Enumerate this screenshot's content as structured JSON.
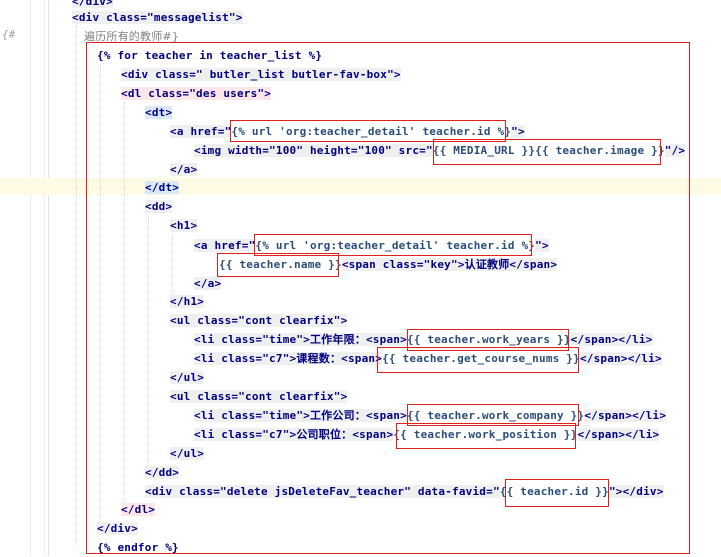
{
  "gutter": {
    "comment_marker": "{#"
  },
  "code": {
    "line_top": "</div>",
    "line_messagelist_open": "<div class=\"messagelist\">",
    "line_comment": "遍历所有的教师#}",
    "line_for": "{% for teacher in teacher_list %}",
    "line_div_butler": "<div class=\" butler_list butler-fav-box\">",
    "line_dl_open": "<dl class=\"des users\">",
    "line_dt_open": "<dt>",
    "line_a1_prefix": "<a href=\"",
    "line_a1_tpl": "{% url 'org:teacher_detail' teacher.id %}",
    "line_a1_suffix": "\">",
    "line_img_prefix": "<img width=\"100\" height=\"100\" src=\"",
    "line_img_tpl": "{{ MEDIA_URL }}{{ teacher.image }}",
    "line_img_suffix": "\"/>",
    "line_a1_close": "</a>",
    "line_dt_close": "</dt>",
    "line_dd_open": "<dd>",
    "line_h1_open": "<h1>",
    "line_a2_prefix": "<a href=\"",
    "line_a2_tpl": "{% url 'org:teacher_detail' teacher.id %}",
    "line_a2_suffix": "\">",
    "line_name_tpl": "{{ teacher.name }}",
    "line_name_rest": "<span class=\"key\">认证教师</span>",
    "line_a2_close": "</a>",
    "line_h1_close": "</h1>",
    "line_ul1_open": "<ul class=\"cont clearfix\">",
    "line_li1_prefix": "<li class=\"time\">工作年限：<span>",
    "line_li1_tpl": "{{ teacher.work_years }}",
    "line_li1_suffix": "</span></li>",
    "line_li2_prefix": "<li class=\"c7\">课程数：<span>",
    "line_li2_tpl": "{{ teacher.get_course_nums }}",
    "line_li2_suffix": "</span></li>",
    "line_ul1_close": "</ul>",
    "line_ul2_open": "<ul class=\"cont clearfix\">",
    "line_li3_prefix": "<li class=\"time\">工作公司：<span>",
    "line_li3_tpl": "{{ teacher.work_company }}",
    "line_li3_suffix": "</span></li>",
    "line_li4_prefix": "<li class=\"c7\">公司职位：<span>",
    "line_li4_tpl": "{{ teacher.work_position }}",
    "line_li4_suffix": "</span></li>",
    "line_ul2_close": "</ul>",
    "line_dd_close": "</dd>",
    "line_del_prefix": "<div class=\"delete jsDeleteFav_teacher\" data-favid=\"",
    "line_del_tpl": "{{ teacher.id }}",
    "line_del_suffix": "\"></div>",
    "line_dl_close": "</dl>",
    "line_div_close": "</div>",
    "line_endfor": "{% endfor %}"
  },
  "colors": {
    "highlight_box": "#e0201a",
    "tag": "#000080",
    "attribute": "#0000ff",
    "value": "#008000",
    "current_line": "#fffae3"
  }
}
